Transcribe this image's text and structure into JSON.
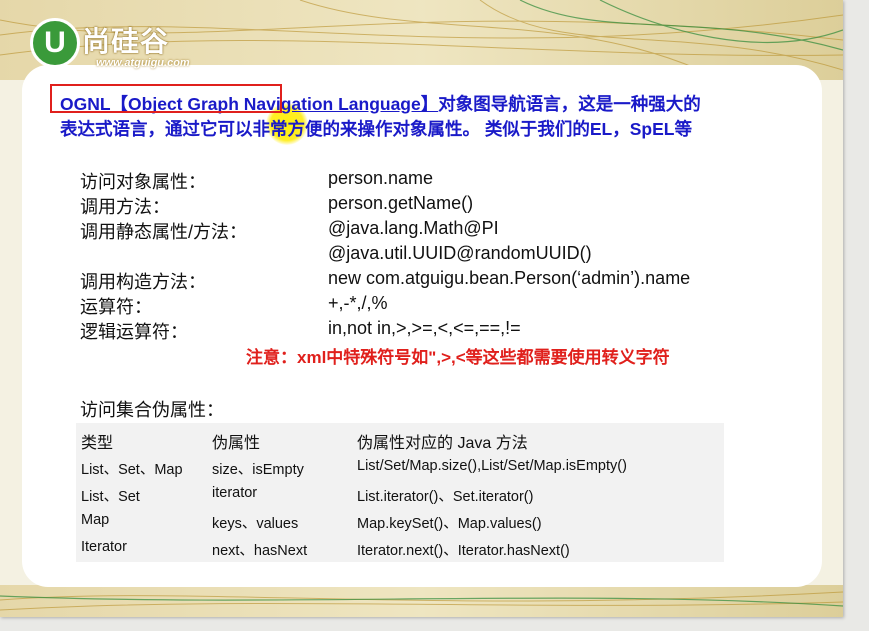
{
  "logo": {
    "mark": "U",
    "brand": "尚硅谷",
    "url": "www.atguigu.com"
  },
  "intro": {
    "highlight": "OGNL【Object Graph Navigation Language】",
    "line1_rest": "对象图导航语言，这是一种强大的",
    "line2": "表达式语言，通过它可以非常方便的来操作对象属性。 类似于我们的EL，SpEL等"
  },
  "items": [
    {
      "label": "访问对象属性：",
      "value": "person.name"
    },
    {
      "label": "调用方法：",
      "value": "person.getName()"
    },
    {
      "label": "调用静态属性/方法：",
      "value": "@java.lang.Math@PI"
    },
    {
      "label": "",
      "value": "@java.util.UUID@randomUUID()"
    },
    {
      "label": "调用构造方法：",
      "value": "new com.atguigu.bean.Person(‘admin’).name"
    },
    {
      "label": "运算符：",
      "value": "+,-*,/,%"
    },
    {
      "label": "逻辑运算符：",
      "value": "in,not in,>,>=,<,<=,==,!="
    }
  ],
  "note": "注意：xml中特殊符号如\",>,<等这些都需要使用转义字符",
  "section_title": "访问集合伪属性：",
  "table": {
    "headers": [
      "类型",
      "伪属性",
      "伪属性对应的 Java 方法"
    ],
    "rows": [
      [
        "List、Set、Map",
        "size、isEmpty",
        "List/Set/Map.size(),List/Set/Map.isEmpty()"
      ],
      [
        "List、Set",
        "iterator",
        "List.iterator()、Set.iterator()"
      ],
      [
        "Map",
        "keys、values",
        "Map.keySet()、Map.values()"
      ],
      [
        "Iterator",
        "next、hasNext",
        "Iterator.next()、Iterator.hasNext()"
      ]
    ]
  },
  "colors": {
    "intro_text": "#1a1ac8",
    "note_text": "#e0201c",
    "red_box": "#e0201c",
    "logo_green": "#3a9a3a"
  }
}
